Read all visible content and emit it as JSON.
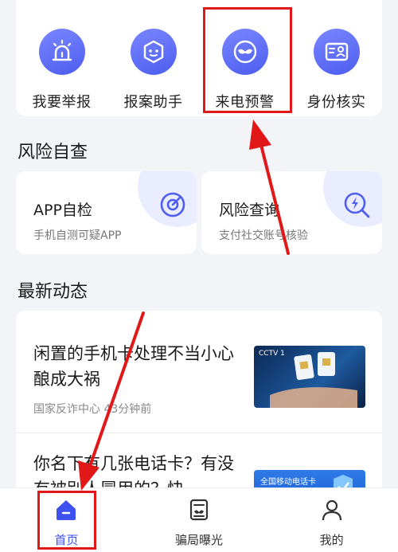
{
  "features": [
    {
      "label": "我要举报",
      "icon": "alarm-light-icon"
    },
    {
      "label": "报案助手",
      "icon": "robot-assistant-icon"
    },
    {
      "label": "来电预警",
      "icon": "mask-call-warning-icon"
    },
    {
      "label": "身份核实",
      "icon": "id-card-icon"
    }
  ],
  "risk_check": {
    "title": "风险自查",
    "cards": [
      {
        "title": "APP自检",
        "subtitle": "手机自测可疑APP",
        "icon": "scan-target-icon"
      },
      {
        "title": "风险查询",
        "subtitle": "支付社交账号核验",
        "icon": "lightning-search-icon"
      }
    ]
  },
  "news": {
    "title": "最新动态",
    "items": [
      {
        "title": "闲置的手机卡处理不当小心酿成大祸",
        "source": "国家反诈中心",
        "time": "43分钟前",
        "thumb_badge": "CCTV 1"
      },
      {
        "title": "你名下有几张电话卡？有没有被别人冒用的？快",
        "thumb_badge": "全国移动电话卡"
      }
    ]
  },
  "navbar": {
    "items": [
      {
        "label": "首页",
        "icon": "home-icon",
        "active": true
      },
      {
        "label": "骗局曝光",
        "icon": "scam-exposure-icon",
        "active": false
      },
      {
        "label": "我的",
        "icon": "user-icon",
        "active": false
      }
    ]
  },
  "colors": {
    "accent": "#3d50f0",
    "annotation": "#e01818"
  }
}
